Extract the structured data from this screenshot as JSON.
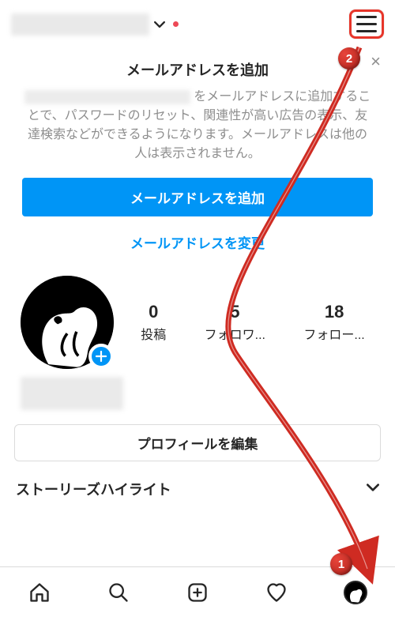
{
  "header": {},
  "promo": {
    "title": "メールアドレスを追加",
    "body_suffix": " をメールアドレスに追加することで、パスワードのリセット、関連性が高い広告の表示、友達検索などができるようになります。メールアドレスは他の人は表示されません。",
    "primary_button": "メールアドレスを追加",
    "secondary_link": "メールアドレスを変更"
  },
  "stats": [
    {
      "count": "0",
      "label": "投稿"
    },
    {
      "count": "5",
      "label": "フォロワ..."
    },
    {
      "count": "18",
      "label": "フォロー..."
    }
  ],
  "edit_profile_label": "プロフィールを編集",
  "highlights_title": "ストーリーズハイライト",
  "annotations": {
    "marker1": "1",
    "marker2": "2"
  }
}
